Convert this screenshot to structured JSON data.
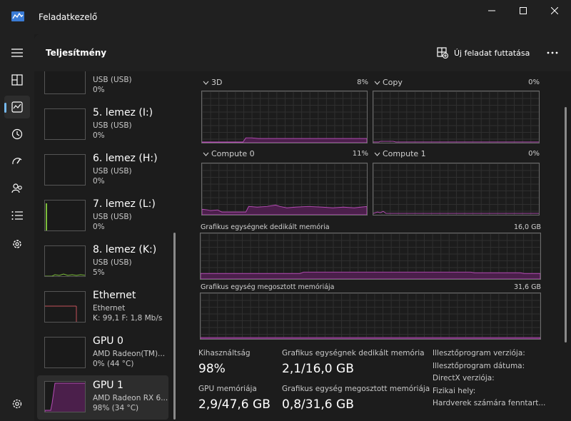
{
  "window": {
    "title": "Feladatkezelő"
  },
  "header": {
    "title": "Teljesítmény",
    "run_task_label": "Új feladat futtatása"
  },
  "devices": [
    {
      "name": "",
      "sub1": "USB (USB)",
      "sub2": "0%"
    },
    {
      "name": "5. lemez (I:)",
      "sub1": "USB (USB)",
      "sub2": "0%"
    },
    {
      "name": "6. lemez (H:)",
      "sub1": "USB (USB)",
      "sub2": "0%"
    },
    {
      "name": "7. lemez (L:)",
      "sub1": "USB (USB)",
      "sub2": "0%"
    },
    {
      "name": "8. lemez (K:)",
      "sub1": "USB (USB)",
      "sub2": "5%"
    },
    {
      "name": "Ethernet",
      "sub1": "Ethernet",
      "sub2": "K: 99,1  F: 1,8 Mb/s"
    },
    {
      "name": "GPU 0",
      "sub1": "AMD Radeon(TM)...",
      "sub2": "0%  (44 °C)"
    },
    {
      "name": "GPU 1",
      "sub1": "AMD Radeon RX 6...",
      "sub2": "98%  (34 °C)"
    }
  ],
  "engines": [
    {
      "name": "3D",
      "pct": "8%"
    },
    {
      "name": "Copy",
      "pct": "0%"
    },
    {
      "name": "Compute 0",
      "pct": "11%"
    },
    {
      "name": "Compute 1",
      "pct": "0%"
    }
  ],
  "memory_graphs": {
    "dedicated": {
      "label": "Grafikus egységnek dedikált memória",
      "max": "16,0 GB"
    },
    "shared": {
      "label": "Grafikus egység megosztott memóriája",
      "max": "31,6 GB"
    }
  },
  "stats": {
    "utilization": {
      "label": "Kihasználtság",
      "value": "98%"
    },
    "dedicated": {
      "label": "Grafikus egységnek dedikált memória",
      "value": "2,1/16,0 GB"
    },
    "gpu_memory": {
      "label": "GPU memóriája",
      "value": "2,9/47,6 GB"
    },
    "shared": {
      "label": "Grafikus egység megosztott memóriája",
      "value": "0,8/31,6 GB"
    }
  },
  "info_labels": [
    "Illesztőprogram verziója:",
    "Illesztőprogram dátuma:",
    "DirectX verziója:",
    "Fizikai hely:",
    "Hardverek számára fenntart..."
  ],
  "colors": {
    "gpu_line": "#b44cb4",
    "gpu_fill": "#4b1f4b",
    "disk_line": "#7cbd3a",
    "net_line": "#c4515a",
    "accent": "#76b9ed"
  },
  "icons": [
    "app-icon",
    "minimize-icon",
    "maximize-icon",
    "close-icon",
    "hamburger-icon",
    "processes-icon",
    "performance-icon",
    "history-icon",
    "startup-icon",
    "users-icon",
    "details-icon",
    "services-icon",
    "settings-icon",
    "run-task-icon",
    "more-icon",
    "chevron-down-icon"
  ]
}
